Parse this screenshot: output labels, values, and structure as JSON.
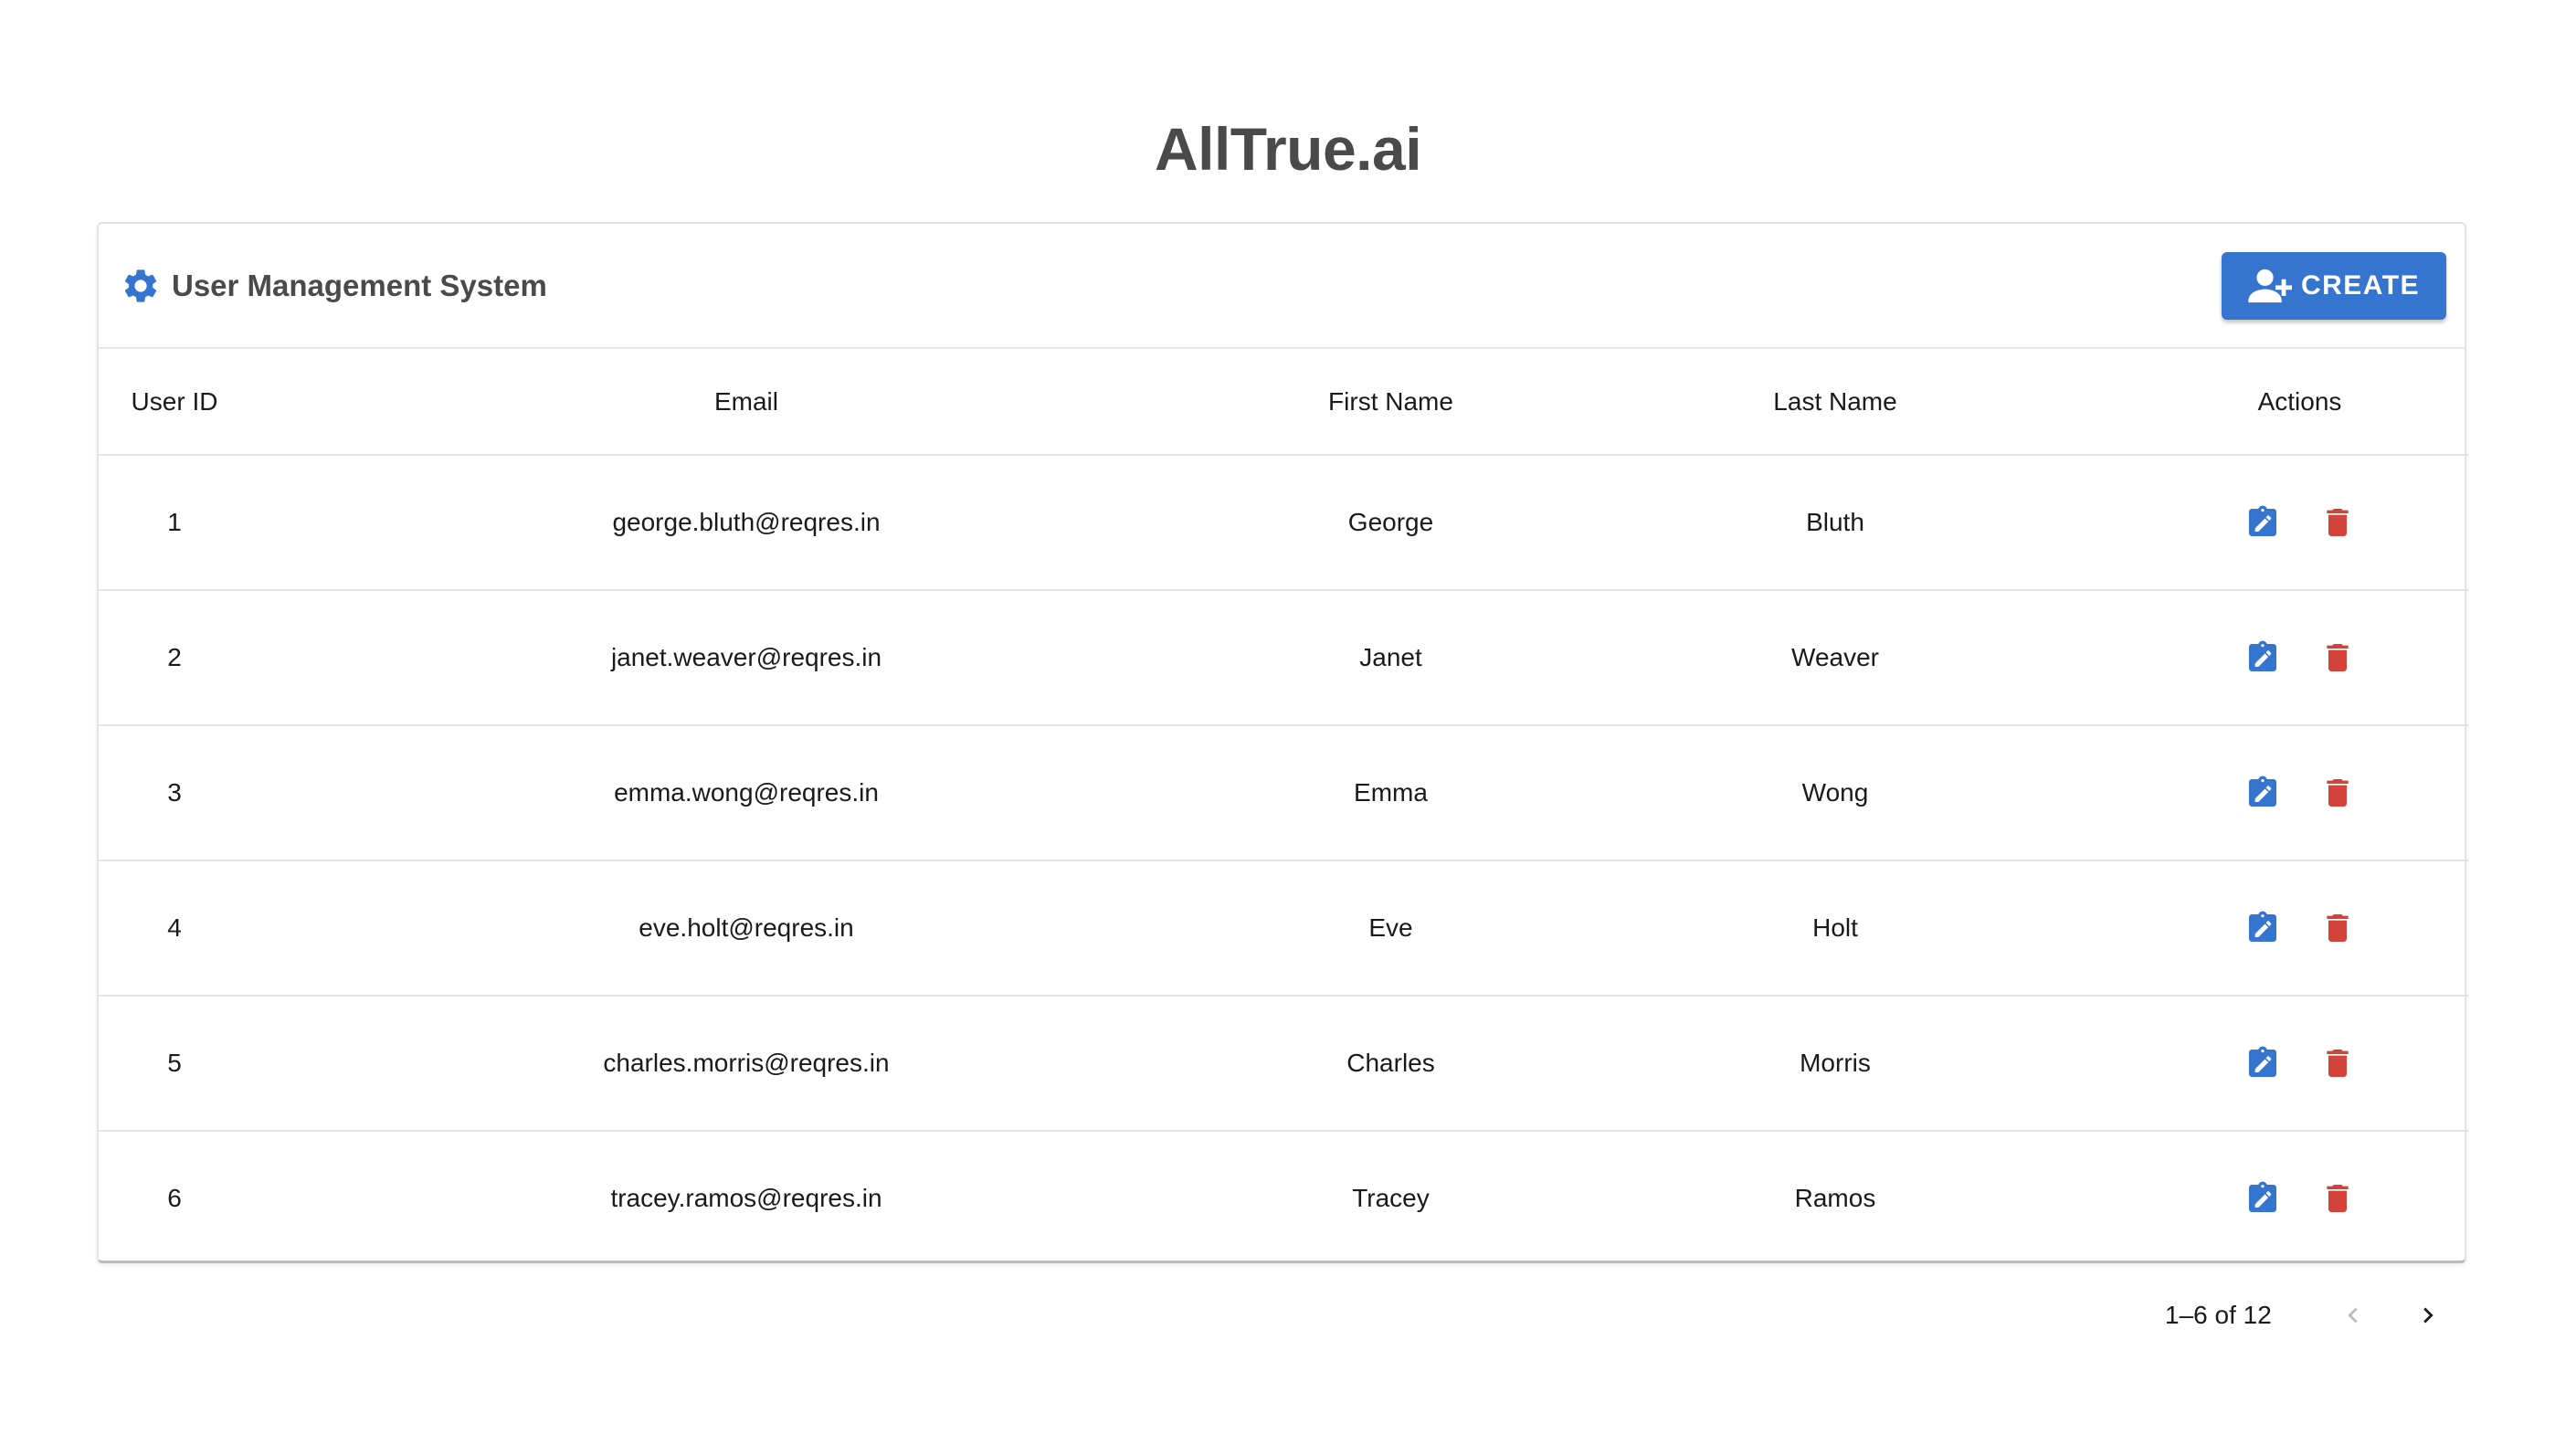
{
  "app": {
    "title": "AllTrue.ai"
  },
  "card": {
    "title": "User Management System",
    "header_icon": "gear-icon",
    "create_label": "CREATE",
    "create_icon": "person-add-icon"
  },
  "table": {
    "columns": [
      "User ID",
      "Email",
      "First Name",
      "Last Name",
      "Actions"
    ],
    "rows": [
      {
        "id": "1",
        "email": "george.bluth@reqres.in",
        "first_name": "George",
        "last_name": "Bluth"
      },
      {
        "id": "2",
        "email": "janet.weaver@reqres.in",
        "first_name": "Janet",
        "last_name": "Weaver"
      },
      {
        "id": "3",
        "email": "emma.wong@reqres.in",
        "first_name": "Emma",
        "last_name": "Wong"
      },
      {
        "id": "4",
        "email": "eve.holt@reqres.in",
        "first_name": "Eve",
        "last_name": "Holt"
      },
      {
        "id": "5",
        "email": "charles.morris@reqres.in",
        "first_name": "Charles",
        "last_name": "Morris"
      },
      {
        "id": "6",
        "email": "tracey.ramos@reqres.in",
        "first_name": "Tracey",
        "last_name": "Ramos"
      }
    ],
    "row_actions": [
      "edit-clipboard-icon",
      "delete-trash-icon"
    ]
  },
  "pagination": {
    "range_label": "1–6 of 12",
    "prev_icon": "chevron-left-icon",
    "next_icon": "chevron-right-icon",
    "prev_disabled": true
  },
  "colors": {
    "primary": "#3575d0",
    "danger": "#d4433a",
    "title_text": "#4a4a4a"
  }
}
